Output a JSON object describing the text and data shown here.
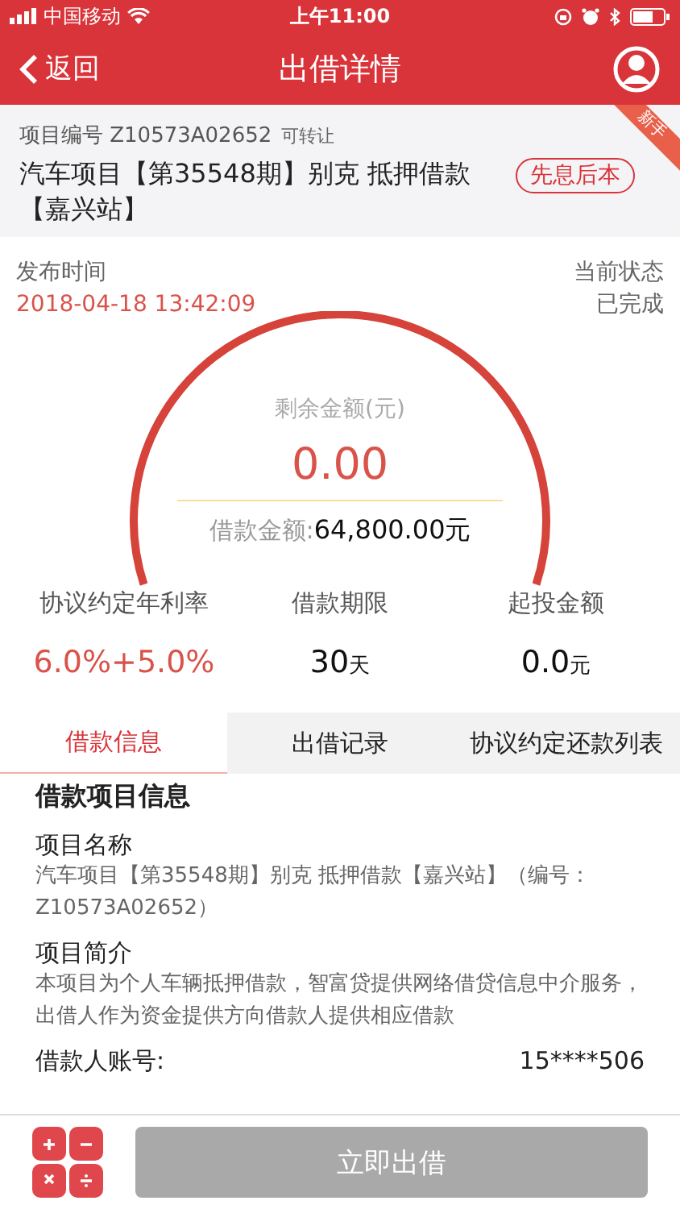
{
  "status_bar": {
    "carrier": "中国移动",
    "time": "上午11:00"
  },
  "nav": {
    "back": "返回",
    "title": "出借详情"
  },
  "project": {
    "number_label": "项目编号",
    "number": "Z10573A02652",
    "transferable": "可转让",
    "title": "汽车项目【第35548期】别克 抵押借款【嘉兴站】",
    "repayment_tag": "先息后本",
    "ribbon": "新手"
  },
  "publish": {
    "label": "发布时间",
    "time": "2018-04-18 13:42:09"
  },
  "status": {
    "label": "当前状态",
    "value": "已完成"
  },
  "gauge": {
    "label": "剩余金额(元)",
    "remaining": "0.00",
    "amount_label": "借款金额:",
    "amount": "64,800.00元"
  },
  "stats": [
    {
      "label": "协议约定年利率",
      "value": "6.0%+5.0%",
      "highlight": true
    },
    {
      "label": "借款期限",
      "value": "30",
      "unit": "天",
      "highlight": false
    },
    {
      "label": "起投金额",
      "value": "0.0",
      "unit": "元",
      "highlight": false
    }
  ],
  "tabs": [
    {
      "label": "借款信息",
      "selected": true
    },
    {
      "label": "出借记录",
      "selected": false
    },
    {
      "label": "协议约定还款列表",
      "selected": false
    }
  ],
  "info": {
    "heading": "借款项目信息",
    "sections": [
      {
        "title": "项目名称",
        "text": "汽车项目【第35548期】别克 抵押借款【嘉兴站】（编号：Z10573A02652）"
      },
      {
        "title": "项目简介",
        "text": "本项目为个人车辆抵押借款，智富贷提供网络借贷信息中介服务，出借人作为资金提供方向借款人提供相应借款"
      }
    ],
    "account": {
      "label": "借款人账号:",
      "value": "15****506"
    }
  },
  "invest_button": {
    "label": "立即出借",
    "disabled": true
  }
}
